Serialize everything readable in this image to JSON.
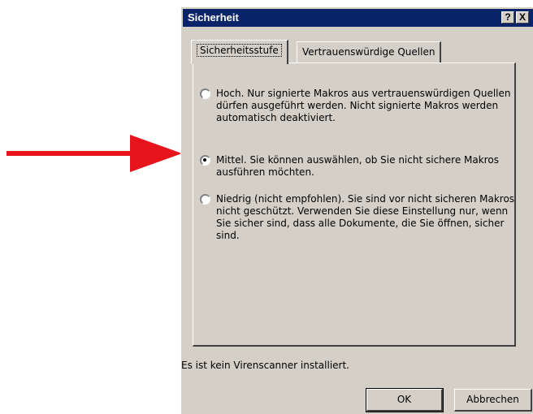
{
  "window": {
    "title": "Sicherheit",
    "help_label": "?",
    "close_label": "X"
  },
  "tabs": [
    {
      "label": "Sicherheitsstufe",
      "active": true
    },
    {
      "label": "Vertrauenswürdige Quellen",
      "active": false
    }
  ],
  "options": [
    {
      "label": "Hoch. Nur signierte Makros aus vertrauenswürdigen Quellen dürfen ausgeführt werden.  Nicht signierte Makros werden automatisch deaktiviert.",
      "selected": false
    },
    {
      "label": "Mittel. Sie können auswählen, ob Sie nicht sichere Makros ausführen möchten.",
      "selected": true
    },
    {
      "label": "Niedrig (nicht empfohlen). Sie sind vor nicht sicheren Makros nicht geschützt. Verwenden Sie diese Einstellung nur, wenn Sie sicher sind, dass alle Dokumente, die Sie öffnen, sicher sind.",
      "selected": false
    }
  ],
  "status_text": "Es ist kein Virenscanner installiert.",
  "buttons": {
    "ok": "OK",
    "cancel": "Abbrechen"
  },
  "colors": {
    "arrow": "#e8141c",
    "titlebar": "#0a246a",
    "dialog_bg": "#d4d0c8"
  }
}
